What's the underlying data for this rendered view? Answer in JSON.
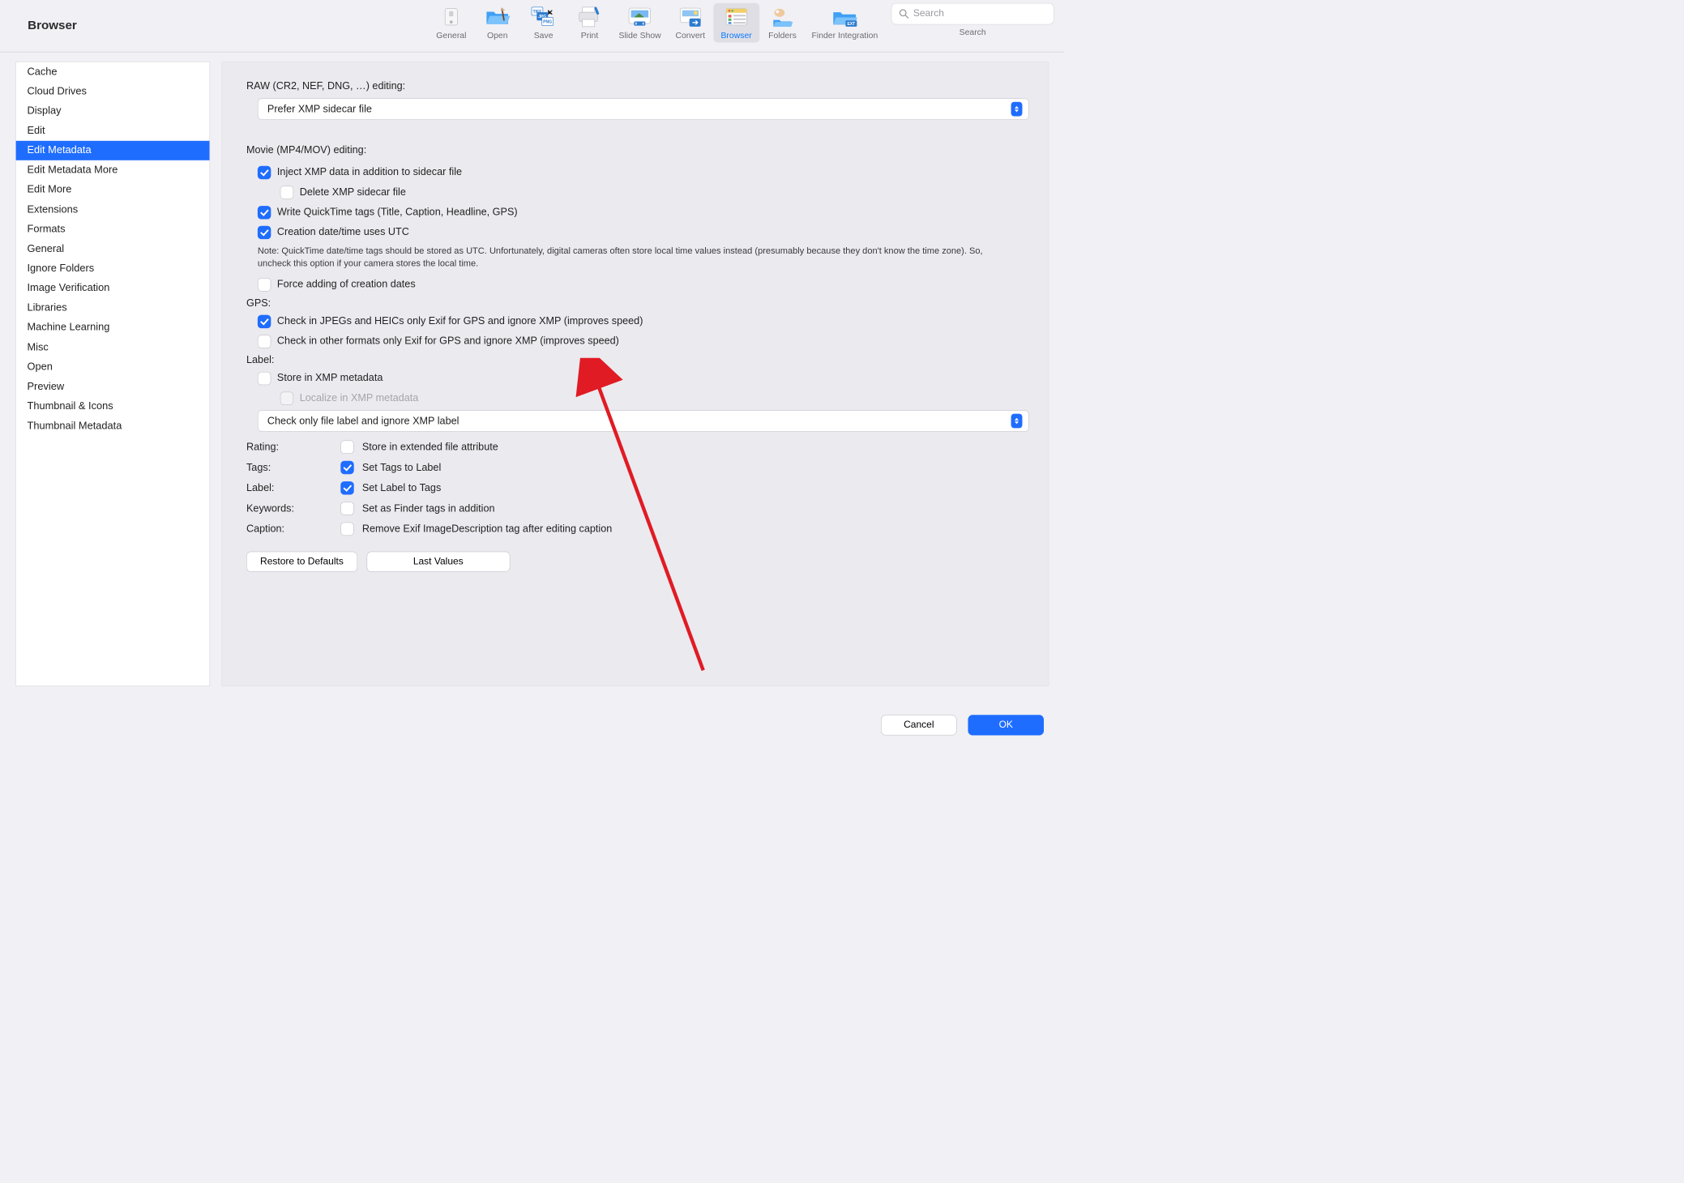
{
  "window": {
    "title": "Browser"
  },
  "toolbar": {
    "items": [
      {
        "id": "general",
        "label": "General"
      },
      {
        "id": "open",
        "label": "Open"
      },
      {
        "id": "save",
        "label": "Save"
      },
      {
        "id": "print",
        "label": "Print"
      },
      {
        "id": "slideshow",
        "label": "Slide Show"
      },
      {
        "id": "convert",
        "label": "Convert"
      },
      {
        "id": "browser",
        "label": "Browser"
      },
      {
        "id": "folders",
        "label": "Folders"
      },
      {
        "id": "finder",
        "label": "Finder Integration"
      }
    ],
    "selected": "browser",
    "search": {
      "placeholder": "Search",
      "caption": "Search"
    }
  },
  "sidebar": {
    "items": [
      "Cache",
      "Cloud Drives",
      "Display",
      "Edit",
      "Edit Metadata",
      "Edit Metadata More",
      "Edit More",
      "Extensions",
      "Formats",
      "General",
      "Ignore Folders",
      "Image Verification",
      "Libraries",
      "Machine Learning",
      "Misc",
      "Open",
      "Preview",
      "Thumbnail & Icons",
      "Thumbnail Metadata"
    ],
    "selected_index": 4
  },
  "content": {
    "raw_label": "RAW (CR2, NEF, DNG, …) editing:",
    "raw_select": "Prefer XMP sidecar file",
    "movie_label": "Movie (MP4/MOV) editing:",
    "movie_inject": "Inject XMP data in addition to sidecar file",
    "movie_delete_sidecar": "Delete XMP sidecar file",
    "movie_write_qt": "Write QuickTime tags (Title, Caption, Headline, GPS)",
    "movie_utc": "Creation date/time uses UTC",
    "movie_note": "Note: QuickTime date/time tags should be stored as UTC. Unfortunately, digital cameras often store local time values instead (presumably because they don't know the time zone). So, uncheck this option if your camera stores the local time.",
    "movie_force": "Force adding of creation dates",
    "gps_label": "GPS:",
    "gps_jpeg": "Check in JPEGs and HEICs only Exif for GPS and ignore XMP (improves speed)",
    "gps_other": "Check in other formats only Exif for GPS and ignore XMP (improves speed)",
    "label_label": "Label:",
    "label_store": "Store in XMP metadata",
    "label_localize": "Localize in XMP metadata",
    "label_select": "Check only file label and ignore XMP label",
    "rating_label": "Rating:",
    "rating_opt": "Store in extended file attribute",
    "tags_label": "Tags:",
    "tags_opt": "Set Tags to Label",
    "label2_label": "Label:",
    "label2_opt": "Set Label to Tags",
    "keywords_label": "Keywords:",
    "keywords_opt": "Set as Finder tags in addition",
    "caption_label": "Caption:",
    "caption_opt": "Remove Exif ImageDescription tag after editing caption",
    "restore_btn": "Restore to Defaults",
    "last_btn": "Last Values"
  },
  "footer": {
    "cancel": "Cancel",
    "ok": "OK"
  }
}
